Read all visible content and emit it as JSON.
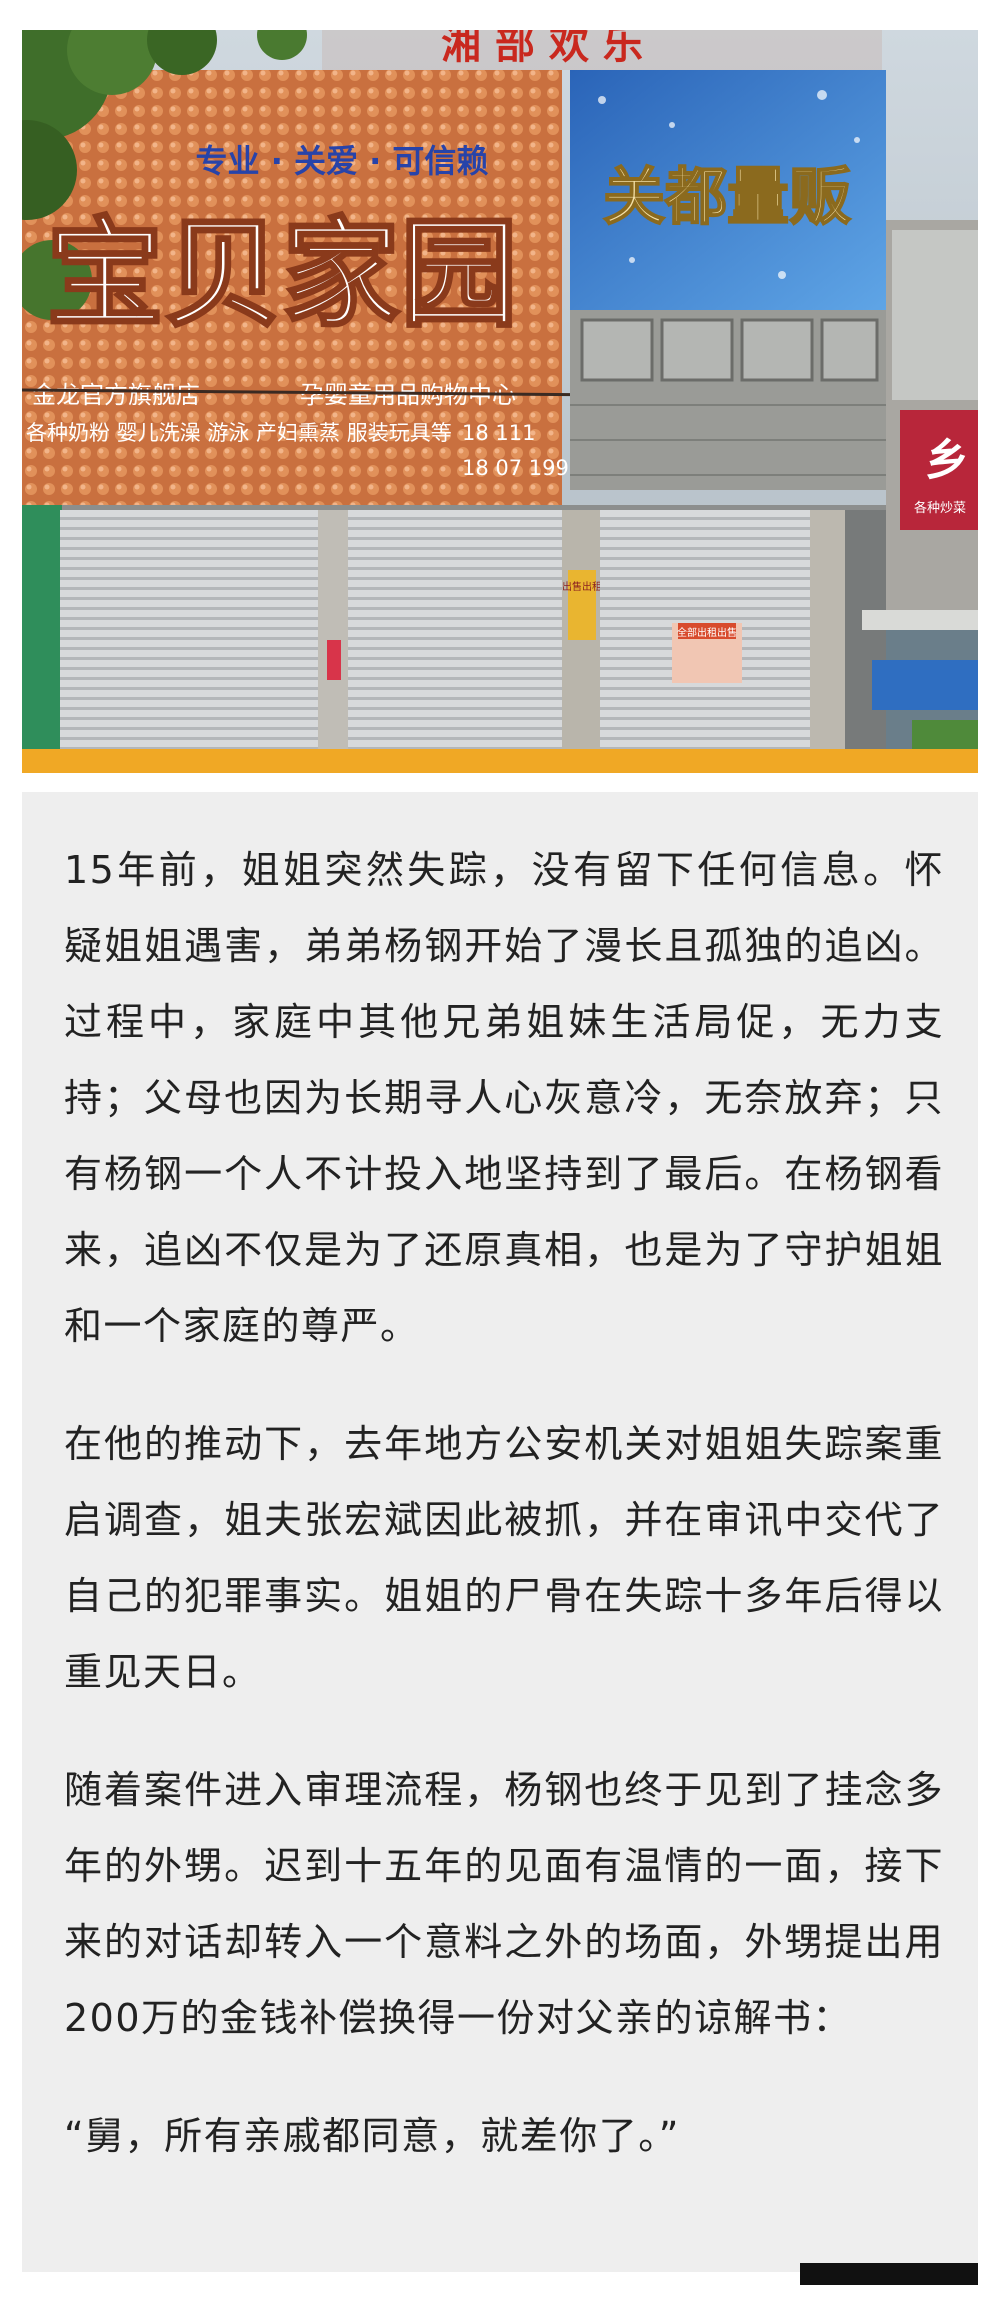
{
  "photo": {
    "sign_top_red": "湘 部 欢 乐",
    "slogan": "专业 · 关爱 · 可信赖",
    "store_name": "宝贝家园",
    "store_subtitle_left": "金龙官方旗舰店",
    "store_subtitle_right": "孕婴童用品购物中心",
    "store_products": "各种奶粉  婴儿洗澡  游泳  产妇熏蒸  服装玩具等",
    "phone_line_1": "18    111",
    "phone_line_2": "18  07 199",
    "wholesale_sign": "关都量贩",
    "right_sign_char": "乡",
    "right_sign_small": "各种炒菜",
    "notice_label": "全部出租出售",
    "small_notice": "出售出租"
  },
  "article": {
    "paragraphs": [
      "15年前，姐姐突然失踪，没有留下任何信息。怀疑姐姐遇害，弟弟杨钢开始了漫长且孤独的追凶。过程中，家庭中其他兄弟姐妹生活局促，无力支持；父母也因为长期寻人心灰意冷，无奈放弃；只有杨钢一个人不计投入地坚持到了最后。在杨钢看来，追凶不仅是为了还原真相，也是为了守护姐姐和一个家庭的尊严。",
      "在他的推动下，去年地方公安机关对姐姐失踪案重启调查，姐夫张宏斌因此被抓，并在审讯中交代了自己的犯罪事实。姐姐的尸骨在失踪十多年后得以重见天日。",
      "随着案件进入审理流程，杨钢也终于见到了挂念多年的外甥。迟到十五年的见面有温情的一面，接下来的对话却转入一个意料之外的场面，外甥提出用200万的金钱补偿换得一份对父亲的谅解书：",
      "“舅，所有亲戚都同意，就差你了。”"
    ]
  },
  "colors": {
    "accent_bar": "#f0a825",
    "card_bg": "#eeeeee",
    "text": "#222222"
  }
}
